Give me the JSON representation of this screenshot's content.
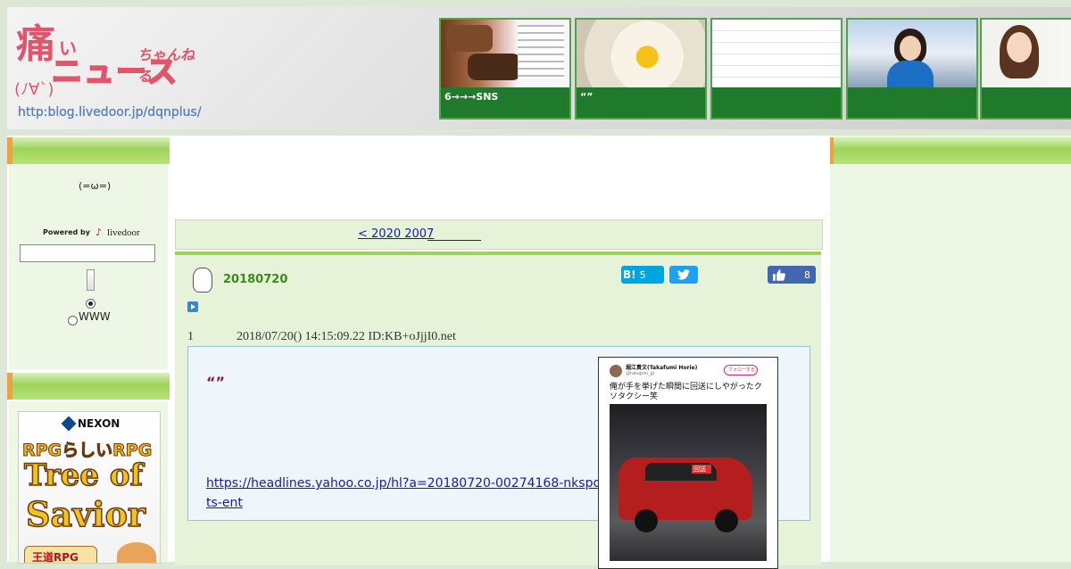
{
  "header": {
    "logo": {
      "title_kanji": "痛",
      "title_ri": "い",
      "title_news": "ニュース",
      "title_channeru": "ちゃんねる",
      "face": "(ﾉ∀`)",
      "url": "http:blog.livedoor.jp/dqnplus/"
    },
    "thumbnails": [
      {
        "caption": "6→→→SNS"
      },
      {
        "caption": "“”"
      },
      {
        "caption": ""
      },
      {
        "caption": ""
      },
      {
        "caption": ""
      }
    ]
  },
  "sidebar": {
    "emoticon": "(=ω=)",
    "powered_by": "Powered by",
    "livedoor": "livedoor",
    "search_placeholder": "",
    "radio_www": "WWW"
  },
  "ad": {
    "brand": "NEXON",
    "tag": "RPGらしいRPG",
    "title_line1": "Tree of",
    "title_line2": "Savior",
    "footer": "王道RPG"
  },
  "main": {
    "nav_link": "< 2020 2007",
    "post": {
      "title": "20180720",
      "hatena_label": "B!",
      "hatena_count": "5",
      "like_count": "8",
      "comment_no": "1",
      "comment_meta": "2018/07/20() 14:15:09.22 ID:KB+oJjjI0.net",
      "quote": "“”",
      "link_line1": "https://headlines.yahoo.co.jp/hl?a=20180720-00274168-nkspor",
      "link_line2": "ts-ent"
    },
    "tweet": {
      "author": "堀江貴文(Takafumi Horie)",
      "handle": "@takapon_jp",
      "follow": "フォローする",
      "text": "俺が手を挙げた瞬間に回送にしやがったクソタクシー笑",
      "sign": "回送"
    }
  },
  "colors": {
    "green_dark": "#1f7a2c",
    "green_bar": "#9dd45a",
    "title_green": "#3a8a1c",
    "link_blue": "#1a1aa6",
    "hatena_blue": "#00a4de",
    "twitter_blue": "#1da1f2",
    "like_blue": "#4267b2"
  }
}
